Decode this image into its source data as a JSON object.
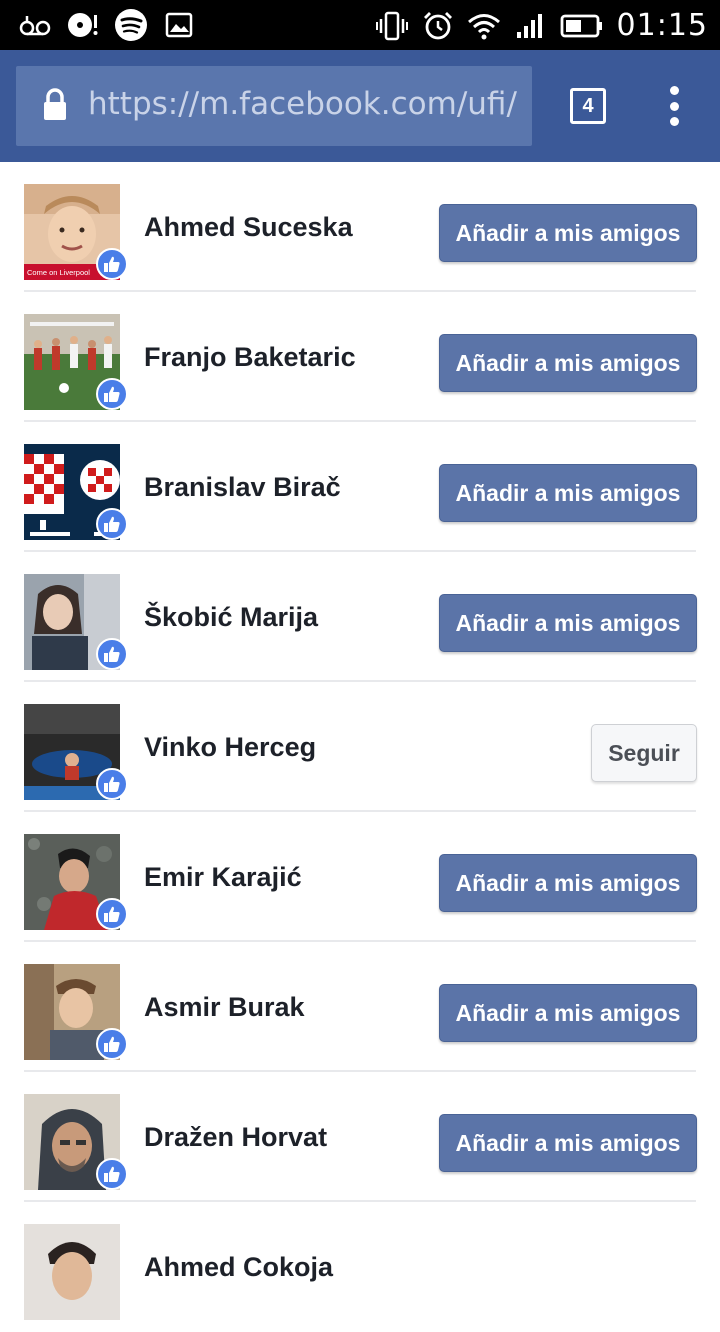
{
  "status_bar": {
    "time": "01:15",
    "left_icons": [
      "voicemail-icon",
      "media-disc-icon",
      "spotify-icon",
      "image-icon"
    ],
    "right_icons": [
      "vibrate-icon",
      "alarm-icon",
      "wifi-icon",
      "signal-icon",
      "battery-icon"
    ]
  },
  "browser": {
    "url": "https://m.facebook.com/ufi/re",
    "tab_count": "4"
  },
  "people": [
    {
      "name": "Ahmed Suceska",
      "action": "Añadir a mis amigos",
      "type": "add",
      "avatar_caption": "Come on Liverpool"
    },
    {
      "name": "Franjo Baketaric",
      "action": "Añadir a mis amigos",
      "type": "add"
    },
    {
      "name": "Branislav Birač",
      "action": "Añadir a mis amigos",
      "type": "add"
    },
    {
      "name": "Škobić Marija",
      "action": "Añadir a mis amigos",
      "type": "add"
    },
    {
      "name": "Vinko Herceg",
      "action": "Seguir",
      "type": "follow"
    },
    {
      "name": "Emir Karajić",
      "action": "Añadir a mis amigos",
      "type": "add"
    },
    {
      "name": "Asmir Burak",
      "action": "Añadir a mis amigos",
      "type": "add"
    },
    {
      "name": "Dražen Horvat",
      "action": "Añadir a mis amigos",
      "type": "add"
    },
    {
      "name": "Ahmed Cokoja",
      "action": "",
      "type": "add"
    }
  ],
  "colors": {
    "facebook_blue": "#3b5998",
    "button_blue": "#5b74a8",
    "like_blue": "#4a7ee8"
  }
}
